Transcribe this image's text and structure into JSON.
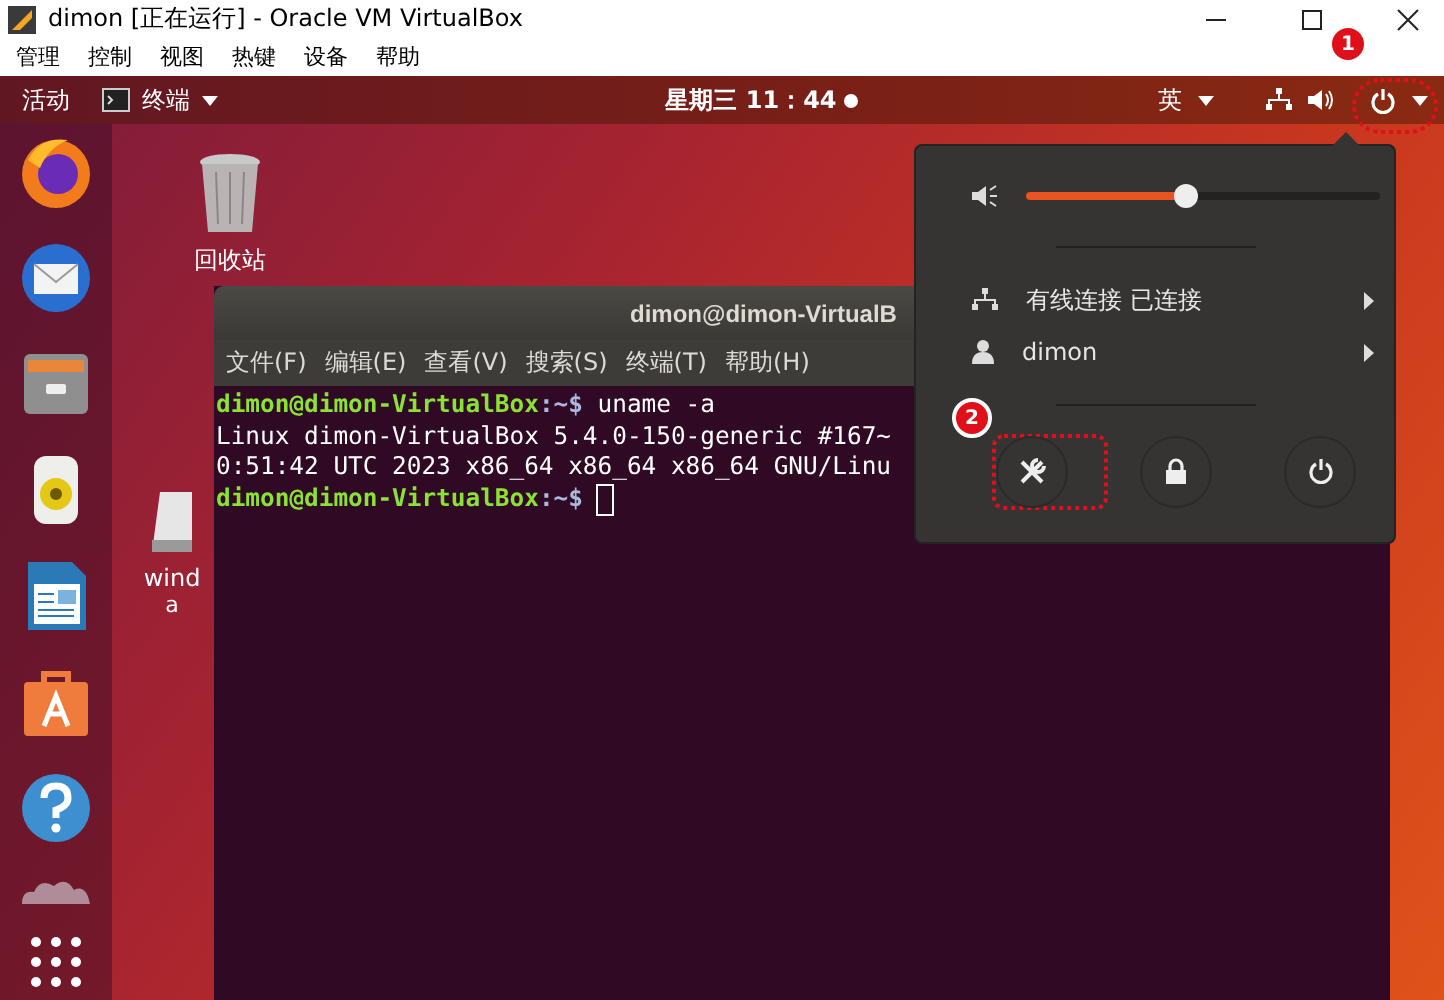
{
  "window": {
    "title": "dimon [正在运行] - Oracle VM VirtualBox"
  },
  "menu": [
    "管理",
    "控制",
    "视图",
    "热键",
    "设备",
    "帮助"
  ],
  "top_bar": {
    "activities": "活动",
    "app_menu": "终端",
    "clock": "星期三 11：44",
    "notification": true,
    "input_method": "英",
    "annotation": "1"
  },
  "dock": [
    {
      "kind": "firefox"
    },
    {
      "kind": "mail"
    },
    {
      "kind": "files"
    },
    {
      "kind": "music"
    },
    {
      "kind": "writer"
    },
    {
      "kind": "software"
    },
    {
      "kind": "help"
    },
    {
      "kind": "partial"
    },
    {
      "kind": "apps"
    }
  ],
  "desktop_icons": [
    {
      "kind": "trash",
      "label": "回收站"
    },
    {
      "kind": "drive",
      "label": "wind",
      "sublabel": "a"
    }
  ],
  "terminal": {
    "title": "dimon@dimon-VirtualB",
    "menu": [
      "文件(F)",
      "编辑(E)",
      "查看(V)",
      "搜索(S)",
      "终端(T)",
      "帮助(H)"
    ],
    "lines": [
      {
        "kind": "prompt",
        "user": "dimon@dimon-VirtualBox",
        "path": ":~$",
        "command": "uname -a",
        "cursor": false
      },
      {
        "kind": "output",
        "text": "Linux dimon-VirtualBox 5.4.0-150-generic #167~"
      },
      {
        "kind": "output",
        "text": "0:51:42 UTC 2023 x86_64 x86_64 x86_64 GNU/Linu"
      },
      {
        "kind": "prompt",
        "user": "dimon@dimon-VirtualBox",
        "path": ":~$",
        "cursor": true
      }
    ]
  },
  "system_menu": {
    "volume": {
      "level": 0.45
    },
    "items": [
      {
        "kind": "network",
        "label": "有线连接 已连接"
      },
      {
        "kind": "user",
        "label": "dimon"
      }
    ],
    "buttons": [
      {
        "kind": "settings",
        "annotation": "2"
      },
      {
        "kind": "lock"
      },
      {
        "kind": "power"
      }
    ]
  }
}
